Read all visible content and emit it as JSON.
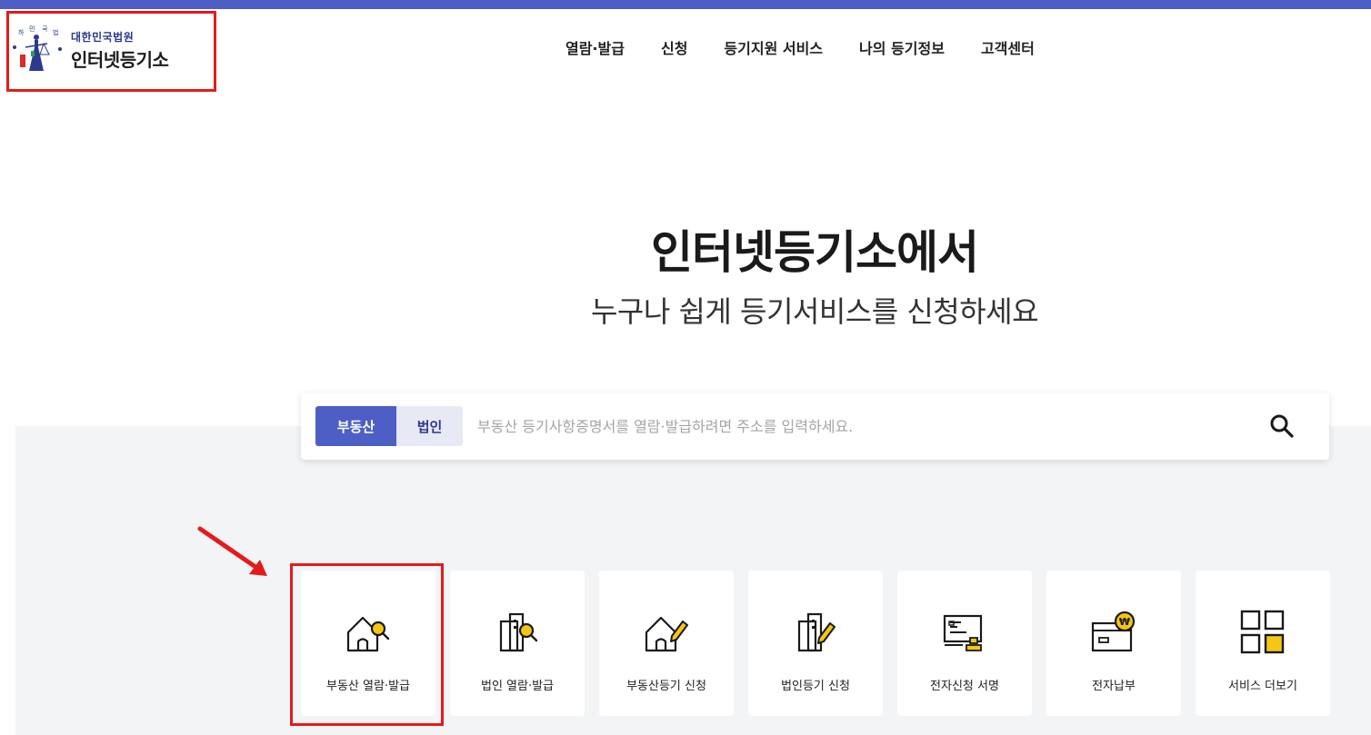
{
  "colors": {
    "brand": "#4d5fc4",
    "accent": "#f5c518",
    "highlight": "#e41b1b",
    "band": "#f3f4f6"
  },
  "logo": {
    "subtitle": "대한민국법원",
    "title": "인터넷등기소",
    "icon": "court-emblem-icon"
  },
  "nav": {
    "items": [
      "열람·발급",
      "신청",
      "등기지원 서비스",
      "나의 등기정보",
      "고객센터"
    ]
  },
  "hero": {
    "title": "인터넷등기소에서",
    "subtitle": "누구나 쉽게 등기서비스를 신청하세요"
  },
  "search": {
    "tabs": [
      {
        "label": "부동산",
        "active": true
      },
      {
        "label": "법인",
        "active": false
      }
    ],
    "placeholder": "부동산 등기사항증명서를 열람·발급하려면 주소를 입력하세요.",
    "button_icon": "search-icon"
  },
  "services": [
    {
      "label": "부동산 열람·발급",
      "icon": "house-search-icon"
    },
    {
      "label": "법인 열람·발급",
      "icon": "building-search-icon"
    },
    {
      "label": "부동산등기 신청",
      "icon": "house-pen-icon"
    },
    {
      "label": "법인등기 신청",
      "icon": "building-pen-icon"
    },
    {
      "label": "전자신청 서명",
      "icon": "document-stamp-icon"
    },
    {
      "label": "전자납부",
      "icon": "card-won-icon"
    },
    {
      "label": "서비스 더보기",
      "icon": "grid-more-icon"
    }
  ]
}
